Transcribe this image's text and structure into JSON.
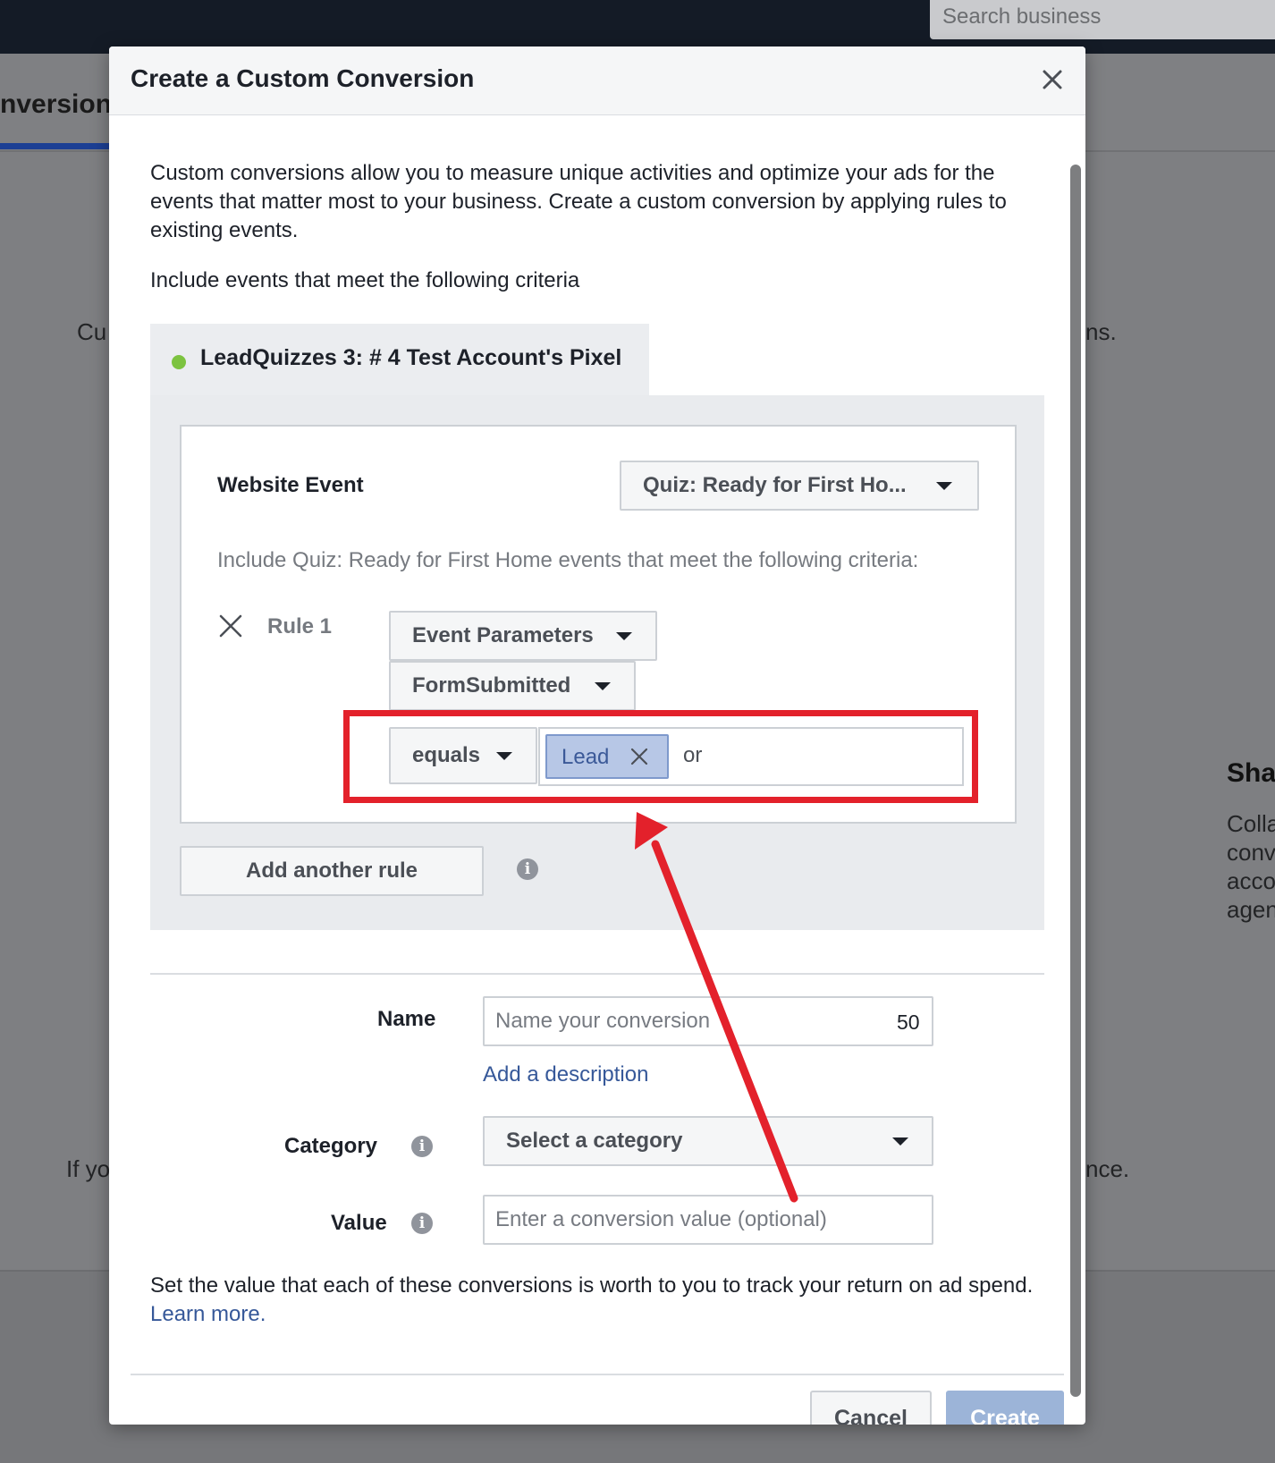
{
  "background": {
    "search_placeholder": "Search business",
    "active_tab_label": "nversions",
    "partial_text_left_1": "Cu",
    "partial_text_right_1": "ns.",
    "partial_heading_right": "Sha",
    "partial_lines_right": [
      "Colla",
      "conv",
      "acco",
      "agen"
    ],
    "partial_text_left_2": "If yo",
    "partial_text_right_2": "nce."
  },
  "modal": {
    "title": "Create a Custom Conversion",
    "close_icon": "close-icon",
    "intro_text": "Custom conversions allow you to measure unique activities and optimize your ads for the events that matter most to your business. Create a custom conversion by applying rules to existing events.",
    "criteria_heading": "Include events that meet the following criteria",
    "pixel": {
      "name": "LeadQuizzes 3: # 4 Test Account's Pixel",
      "status_color": "#7cc340"
    },
    "rule_card": {
      "website_event_label": "Website Event",
      "website_event_value": "Quiz: Ready for First Ho...",
      "include_hint": "Include Quiz: Ready for First Home events that meet the following criteria:",
      "rule_label": "Rule 1",
      "parameter_dropdown": "Event Parameters",
      "field_dropdown": "FormSubmitted",
      "operator_dropdown": "equals",
      "value_token": "Lead",
      "or_text": "or"
    },
    "add_rule_button": "Add another rule",
    "form": {
      "name_label": "Name",
      "name_placeholder": "Name your conversion",
      "name_char_count": "50",
      "add_description_link": "Add a description",
      "category_label": "Category",
      "category_value": "Select a category",
      "value_label": "Value",
      "value_placeholder": "Enter a conversion value (optional)"
    },
    "value_note": "Set the value that each of these conversions is worth to you to track your return on ad spend.",
    "learn_more_link": "Learn more.",
    "cancel_button": "Cancel",
    "create_button": "Create"
  },
  "annotation": {
    "highlight_color": "#e3212b"
  }
}
